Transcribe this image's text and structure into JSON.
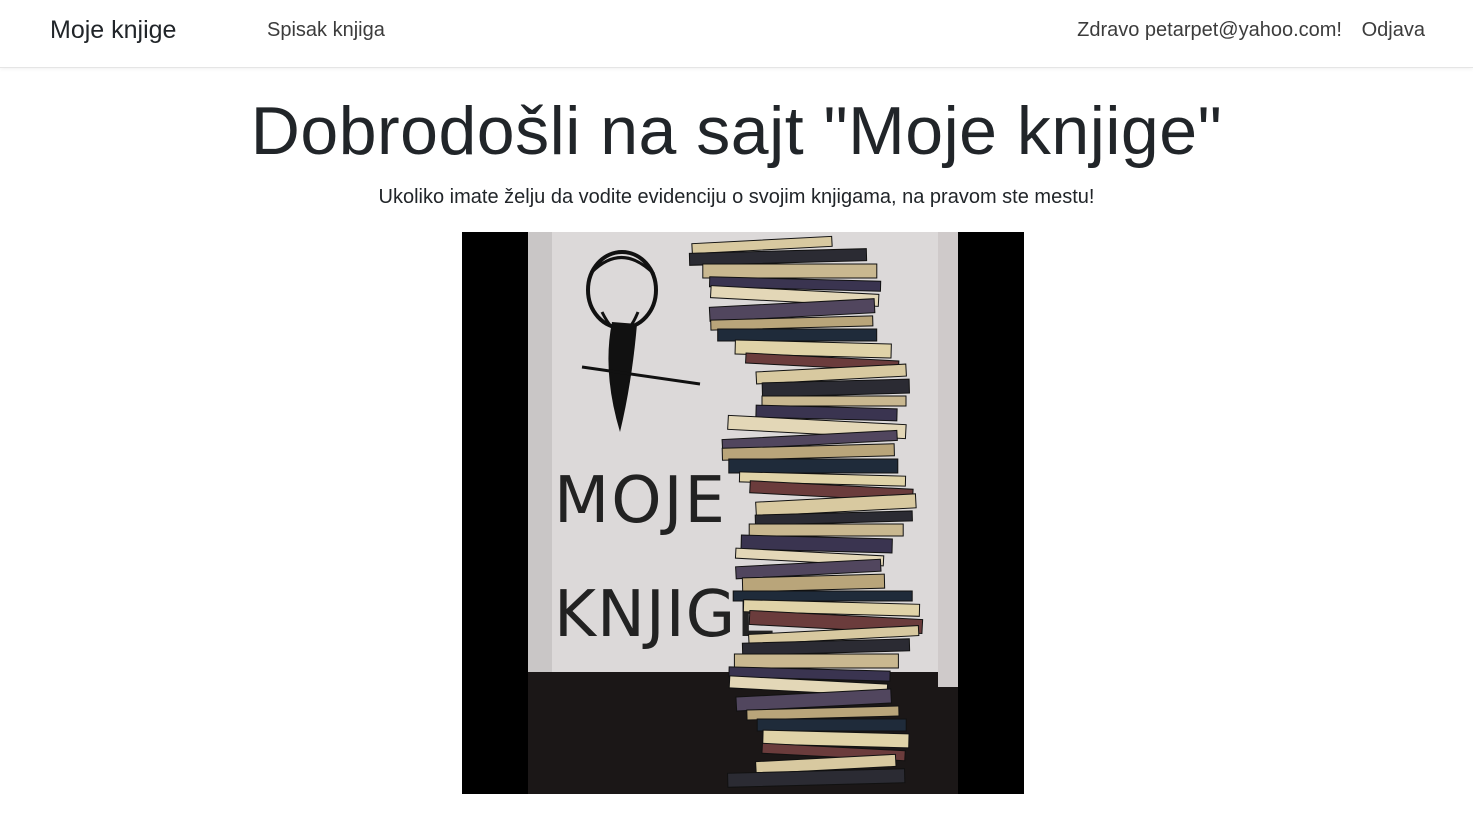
{
  "navbar": {
    "brand": "Moje knjige",
    "links": [
      {
        "label": "Spisak knjiga"
      }
    ],
    "greeting": "Zdravo petarpet@yahoo.com!",
    "logout": "Odjava"
  },
  "hero": {
    "title": "Dobrodošli na sajt \"Moje knjige\"",
    "lead": "Ukoliko imate želju da vodite evidenciju o svojim knjigama, na pravom ste mestu!",
    "image": {
      "text_line1": "MOJE",
      "text_line2": "KNJIGE"
    }
  }
}
